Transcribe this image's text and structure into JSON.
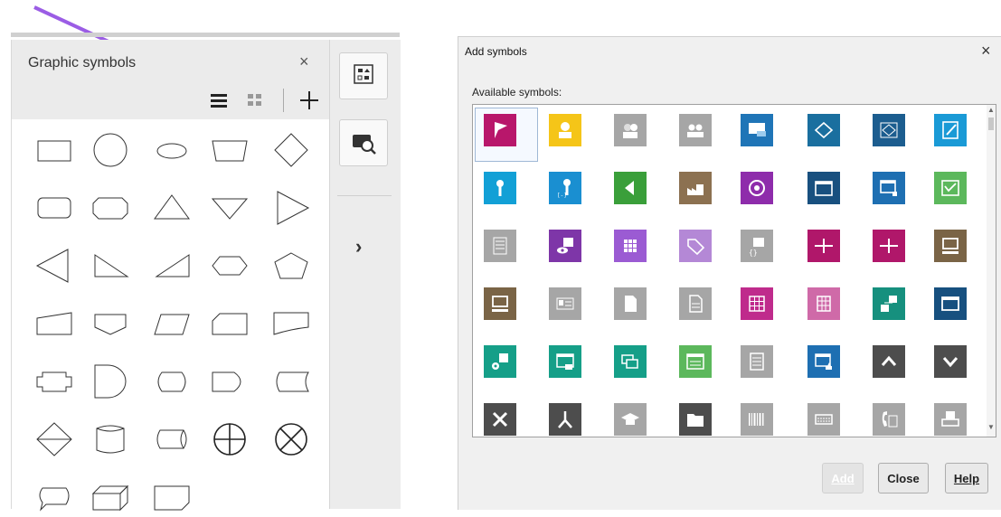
{
  "graphic_symbols_panel": {
    "title": "Graphic symbols",
    "close_glyph": "×",
    "toolbar": {
      "list_view_icon": "list-view-icon",
      "grid_view_icon": "grid-view-icon",
      "add_icon": "plus-icon"
    },
    "shapes": [
      "rectangle",
      "circle",
      "ellipse",
      "trapezoid",
      "diamond",
      "rounded-rectangle",
      "octagon-rectangle",
      "triangle",
      "inverted-triangle",
      "right-triangle-arrow",
      "left-triangle-arrow",
      "right-angle-triangle",
      "right-angle-triangle-flipped",
      "hexagon",
      "pentagon",
      "manual-input",
      "off-page-connector",
      "parallelogram",
      "chamfered-rectangle",
      "card",
      "cross-plus",
      "delay",
      "display",
      "display-alt",
      "stored-data",
      "sort",
      "cylinder",
      "horizontal-cylinder",
      "summing-junction",
      "or-junction",
      "callout",
      "cube",
      "folded-corner"
    ]
  },
  "side_bar": {
    "top_button_icon": "symbol-library-icon",
    "second_button_icon": "search-symbols-icon",
    "expand_glyph": "›"
  },
  "add_symbols_dialog": {
    "title": "Add symbols",
    "close_glyph": "×",
    "available_label": "Available symbols:",
    "buttons": {
      "add": "Add",
      "close": "Close",
      "help": "Help"
    },
    "symbols": [
      {
        "name": "flag",
        "color": "#b8176b"
      },
      {
        "name": "person",
        "color": "#f5c518"
      },
      {
        "name": "group",
        "color": "#a6a6a6"
      },
      {
        "name": "group-gray",
        "color": "#a6a6a6"
      },
      {
        "name": "monitor-card",
        "color": "#1f75b7"
      },
      {
        "name": "diamond-outline",
        "color": "#1a6f9f"
      },
      {
        "name": "diamond-box",
        "color": "#1c5d8f"
      },
      {
        "name": "pencil-note",
        "color": "#1a9ad6"
      },
      {
        "name": "key",
        "color": "#12a0d6"
      },
      {
        "name": "key-code",
        "color": "#1a8fd1"
      },
      {
        "name": "play-left",
        "color": "#3a9f3a"
      },
      {
        "name": "factory",
        "color": "#8c7151"
      },
      {
        "name": "steering",
        "color": "#8e2cab"
      },
      {
        "name": "window",
        "color": "#18507f"
      },
      {
        "name": "window-plugin",
        "color": "#1e6fb2"
      },
      {
        "name": "image-check",
        "color": "#5cb85c"
      },
      {
        "name": "list",
        "color": "#a6a6a6"
      },
      {
        "name": "eye-grid",
        "color": "#7e36a8"
      },
      {
        "name": "grid-purple",
        "color": "#9b5bd3"
      },
      {
        "name": "tag",
        "color": "#b488d6"
      },
      {
        "name": "code-grid",
        "color": "#a6a6a6"
      },
      {
        "name": "node-magenta",
        "color": "#b0176a"
      },
      {
        "name": "node-magenta-2",
        "color": "#b0176a"
      },
      {
        "name": "computer",
        "color": "#7a6446"
      },
      {
        "name": "computer-brown",
        "color": "#7a6446"
      },
      {
        "name": "id-card",
        "color": "#a6a6a6"
      },
      {
        "name": "document",
        "color": "#a6a6a6"
      },
      {
        "name": "document-lines",
        "color": "#a6a6a6"
      },
      {
        "name": "table-magenta",
        "color": "#bf2b8c"
      },
      {
        "name": "table-pink",
        "color": "#cf6aa8"
      },
      {
        "name": "hierarchy",
        "color": "#16907e"
      },
      {
        "name": "window-blue",
        "color": "#17507f"
      },
      {
        "name": "device-network",
        "color": "#159f88"
      },
      {
        "name": "window-green",
        "color": "#159f88"
      },
      {
        "name": "windows-stack",
        "color": "#159f88"
      },
      {
        "name": "browser-green",
        "color": "#5cb85c"
      },
      {
        "name": "list-box",
        "color": "#a6a6a6"
      },
      {
        "name": "window-star",
        "color": "#1e6fb2"
      },
      {
        "name": "chevron-up",
        "color": "#4d4d4d"
      },
      {
        "name": "chevron-down",
        "color": "#4d4d4d"
      },
      {
        "name": "close-x",
        "color": "#4d4d4d"
      },
      {
        "name": "fork",
        "color": "#4d4d4d"
      },
      {
        "name": "graduation-cap",
        "color": "#a6a6a6"
      },
      {
        "name": "folder",
        "color": "#4d4d4d"
      },
      {
        "name": "barcode",
        "color": "#a6a6a6"
      },
      {
        "name": "keyboard",
        "color": "#a6a6a6"
      },
      {
        "name": "phone",
        "color": "#a6a6a6"
      },
      {
        "name": "printer",
        "color": "#a6a6a6"
      }
    ]
  },
  "annotation": {
    "arrow_color": "#9b5de5"
  }
}
